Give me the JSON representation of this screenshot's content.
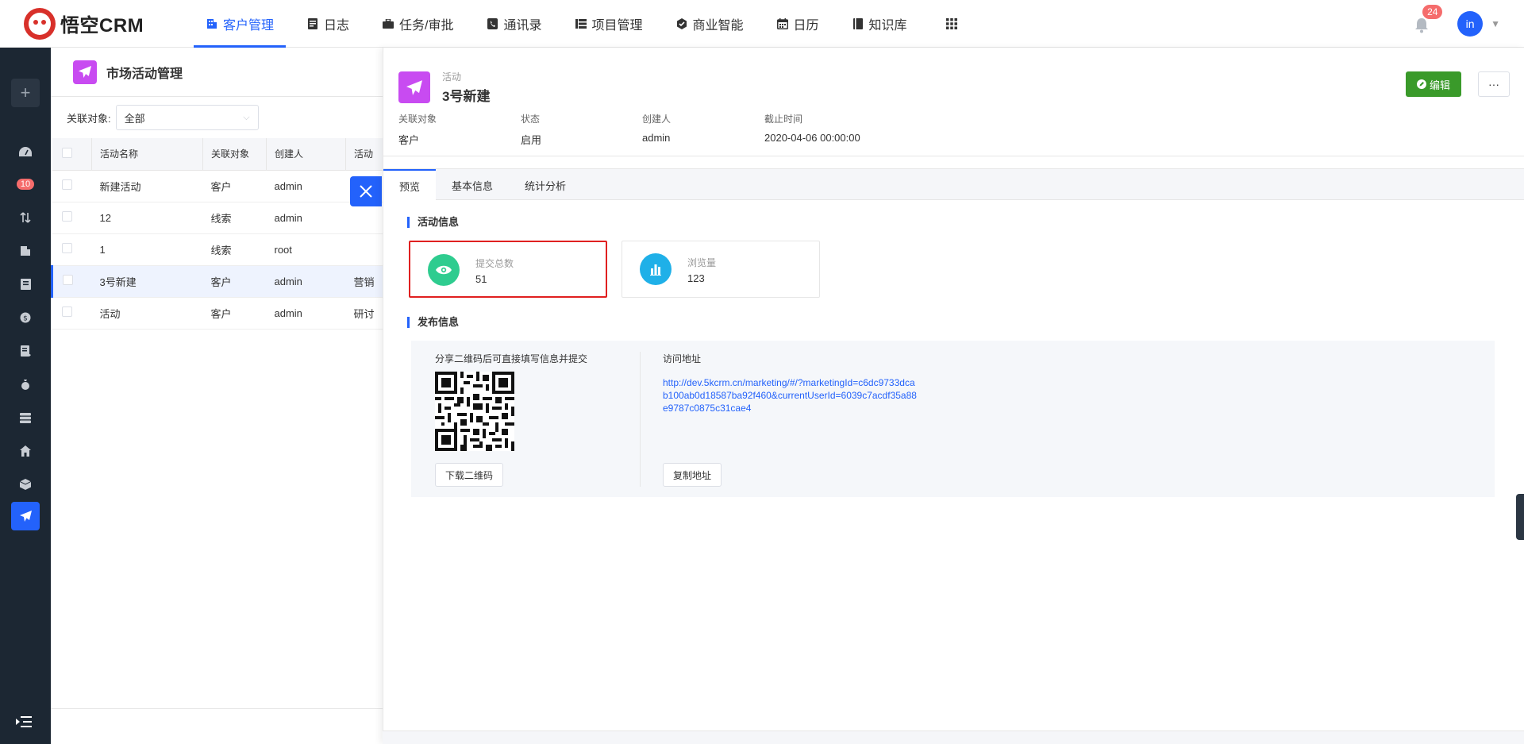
{
  "app": {
    "brand": "悟空CRM"
  },
  "nav": [
    {
      "label": "客户管理",
      "icon": "building-icon",
      "active": true
    },
    {
      "label": "日志",
      "icon": "journal-icon"
    },
    {
      "label": "任务/审批",
      "icon": "briefcase-icon"
    },
    {
      "label": "通讯录",
      "icon": "contacts-icon"
    },
    {
      "label": "项目管理",
      "icon": "project-icon"
    },
    {
      "label": "商业智能",
      "icon": "bi-icon"
    },
    {
      "label": "日历",
      "icon": "calendar-icon"
    },
    {
      "label": "知识库",
      "icon": "book-icon"
    }
  ],
  "header": {
    "notification_count": "24",
    "avatar_text": "in"
  },
  "sidebar": {
    "badge": "10"
  },
  "list": {
    "title": "市场活动管理",
    "filter_label": "关联对象:",
    "filter_value": "全部",
    "columns": [
      "活动名称",
      "关联对象",
      "创建人",
      "活动"
    ],
    "rows": [
      {
        "name": "新建活动",
        "object": "客户",
        "creator": "admin",
        "extra": ""
      },
      {
        "name": "12",
        "object": "线索",
        "creator": "admin",
        "extra": ""
      },
      {
        "name": "1",
        "object": "线索",
        "creator": "root",
        "extra": ""
      },
      {
        "name": "3号新建",
        "object": "客户",
        "creator": "admin",
        "extra": "营销"
      },
      {
        "name": "活动",
        "object": "客户",
        "creator": "admin",
        "extra": "研讨"
      }
    ]
  },
  "detail": {
    "subtitle": "活动",
    "title": "3号新建",
    "edit_label": "编辑",
    "more_label": "···",
    "meta": [
      {
        "label": "关联对象",
        "value": "客户"
      },
      {
        "label": "状态",
        "value": "启用"
      },
      {
        "label": "创建人",
        "value": "admin"
      },
      {
        "label": "截止时间",
        "value": "2020-04-06 00:00:00"
      }
    ],
    "tabs": [
      "预览",
      "基本信息",
      "统计分析"
    ],
    "activity_section": "活动信息",
    "stats": [
      {
        "label": "提交总数",
        "value": "51",
        "color": "#2ecc8f"
      },
      {
        "label": "浏览量",
        "value": "123",
        "color": "#1fb0e8"
      }
    ],
    "publish_section": "发布信息",
    "qr_caption": "分享二维码后可直接填写信息并提交",
    "download_qr": "下载二维码",
    "url_caption": "访问地址",
    "url": "http://dev.5kcrm.cn/marketing/#/?marketingId=c6dc9733dcab100ab0d18587ba92f460&currentUserId=6039c7acdf35a88e9787c0875c31cae4",
    "copy_url": "复制地址"
  },
  "colors": {
    "accent": "#2362fb",
    "edit": "#3a9a2a",
    "highlight": "#e02020",
    "activity_icon": "#c84bf1"
  }
}
